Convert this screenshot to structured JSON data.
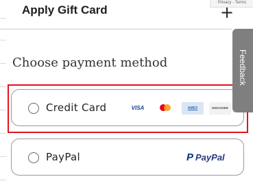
{
  "recaptcha": {
    "text": "Privacy - Terms"
  },
  "gift_card": {
    "title": "Apply Gift Card",
    "toggle": "+"
  },
  "payment": {
    "title": "Choose payment method",
    "options": [
      {
        "label": "Credit Card",
        "cards": [
          "VISA",
          "AMEX",
          "DISCOVER"
        ]
      },
      {
        "label": "PayPal",
        "logo_text": "PayPal",
        "logo_mark": "P"
      }
    ]
  },
  "feedback": {
    "label": "Feedback"
  },
  "colors": {
    "highlight": "#e0131f",
    "feedback_bg": "#7f7f7f",
    "paypal_dark": "#253b80",
    "paypal_light": "#179bd7"
  }
}
